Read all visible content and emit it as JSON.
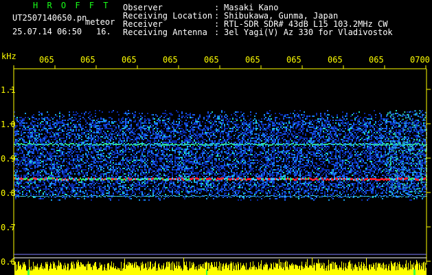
{
  "app": {
    "title": "H R O F F T",
    "filename": "UT2507140650.pn",
    "mode_label": "meteor",
    "timestamp": "25.07.14 06:50",
    "count": "16."
  },
  "info": {
    "rows": [
      {
        "label": "Observer",
        "value": "Masaki Kano"
      },
      {
        "label": "Receiving Location",
        "value": "Shibukawa, Gunma, Japan"
      },
      {
        "label": "Receiver",
        "value": "RTL-SDR SDR# 43dB L15 103.2MHz CW"
      },
      {
        "label": "Receiving Antenna",
        "value": "3el Yagi(V) Az 330 for Vladivostok"
      }
    ]
  },
  "axis": {
    "unit": "kHz",
    "time_ticks": [
      "065",
      "065",
      "065",
      "065",
      "065",
      "065",
      "065",
      "065",
      "065",
      "0700"
    ],
    "freq_ticks": [
      "1.1",
      "1.0",
      "0.9",
      "0.8",
      "0.7",
      "0.6"
    ]
  },
  "colors": {
    "background": "#000000",
    "axis": "#ffff00",
    "header_text": "#ffffff",
    "title": "#19ff19",
    "noise": "#1040e0",
    "echo": "#ff2030"
  }
}
